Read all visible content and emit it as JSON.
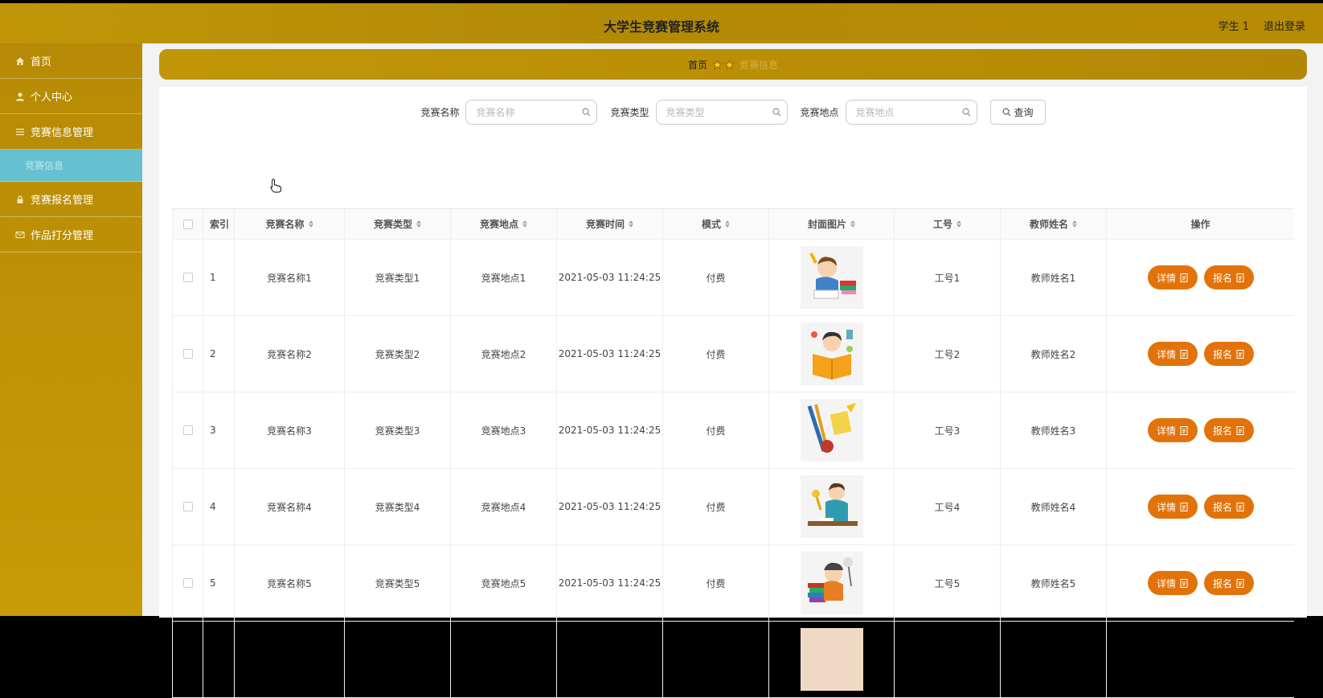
{
  "app": {
    "title": "大学生竞赛管理系统",
    "user_label": "学生 1",
    "logout_label": "退出登录"
  },
  "sidebar": {
    "items": [
      {
        "label": "首页",
        "icon": "home-icon"
      },
      {
        "label": "个人中心",
        "icon": "user-icon"
      },
      {
        "label": "竞赛信息管理",
        "icon": "list-icon"
      },
      {
        "label": "竞赛信息",
        "icon": ""
      },
      {
        "label": "竞赛报名管理",
        "icon": "lock-icon"
      },
      {
        "label": "作品打分管理",
        "icon": "mail-icon"
      }
    ]
  },
  "breadcrumb": {
    "home": "首页",
    "current": "竞赛信息"
  },
  "search": {
    "name_label": "竞赛名称",
    "name_placeholder": "竞赛名称",
    "type_label": "竞赛类型",
    "type_placeholder": "竞赛类型",
    "place_label": "竞赛地点",
    "place_placeholder": "竞赛地点",
    "query_label": "查询"
  },
  "table": {
    "headers": [
      "索引",
      "竞赛名称",
      "竞赛类型",
      "竞赛地点",
      "竞赛时间",
      "模式",
      "封面图片",
      "工号",
      "教师姓名",
      "操作"
    ],
    "detail_label": "详情",
    "signup_label": "报名",
    "rows": [
      {
        "index": "1",
        "name": "竞赛名称1",
        "type": "竞赛类型1",
        "place": "竞赛地点1",
        "time": "2021-05-03 11:24:25",
        "mode": "付费",
        "work_no": "工号1",
        "teacher": "教师姓名1"
      },
      {
        "index": "2",
        "name": "竞赛名称2",
        "type": "竞赛类型2",
        "place": "竞赛地点2",
        "time": "2021-05-03 11:24:25",
        "mode": "付费",
        "work_no": "工号2",
        "teacher": "教师姓名2"
      },
      {
        "index": "3",
        "name": "竞赛名称3",
        "type": "竞赛类型3",
        "place": "竞赛地点3",
        "time": "2021-05-03 11:24:25",
        "mode": "付费",
        "work_no": "工号3",
        "teacher": "教师姓名3"
      },
      {
        "index": "4",
        "name": "竞赛名称4",
        "type": "竞赛类型4",
        "place": "竞赛地点4",
        "time": "2021-05-03 11:24:25",
        "mode": "付费",
        "work_no": "工号4",
        "teacher": "教师姓名4"
      },
      {
        "index": "5",
        "name": "竞赛名称5",
        "type": "竞赛类型5",
        "place": "竞赛地点5",
        "time": "2021-05-03 11:24:25",
        "mode": "付费",
        "work_no": "工号5",
        "teacher": "教师姓名5"
      }
    ]
  },
  "colors": {
    "topbar": "#b98c05",
    "sidebar_active": "#67c0cf",
    "action_button": "#e2730a",
    "star": "#f5c518"
  }
}
